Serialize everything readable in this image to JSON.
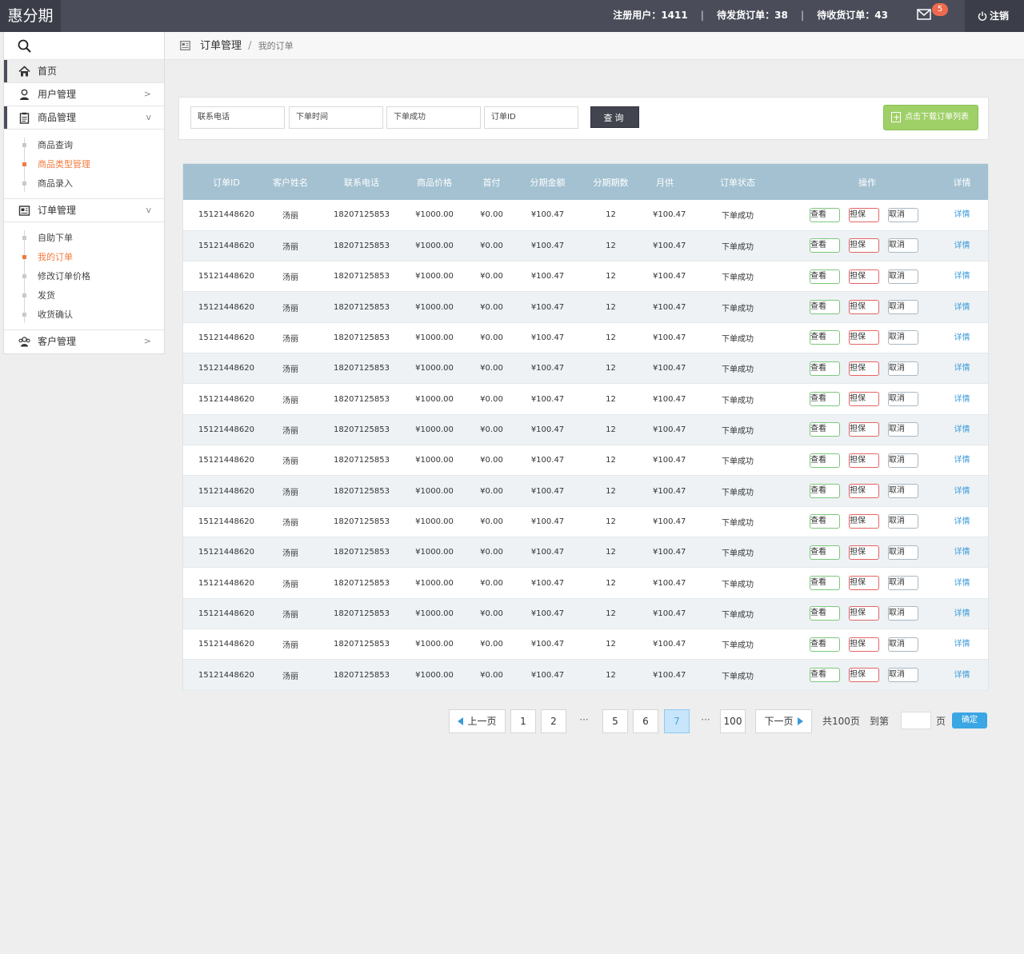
{
  "app": {
    "logo": "惠分期"
  },
  "topbar": {
    "stats": [
      {
        "label": "注册用户：",
        "value": "1411"
      },
      {
        "label": "待发货订单：",
        "value": "38"
      },
      {
        "label": "待收货订单：",
        "value": "43"
      }
    ],
    "separator": "|",
    "mail_badge": "5",
    "logout": "注销"
  },
  "sidebar": {
    "home": "首页",
    "user_mgmt": "用户管理",
    "product_mgmt": "商品管理",
    "product_sub": [
      "商品查询",
      "商品类型管理",
      "商品录入"
    ],
    "order_mgmt": "订单管理",
    "order_sub": [
      "自助下单",
      "我的订单",
      "修改订单价格",
      "发货",
      "收货确认"
    ],
    "customer_mgmt": "客户管理",
    "arrow_right": ">",
    "arrow_down": "v"
  },
  "breadcrumb": {
    "section": "订单管理",
    "sep": "/",
    "current": "我的订单"
  },
  "filter": {
    "phone": "联系电话",
    "time": "下单时间",
    "status": "下单成功",
    "order_id": "订单ID",
    "query": "查询",
    "download": "点击下载订单列表"
  },
  "table": {
    "headers": [
      "订单ID",
      "客户姓名",
      "联系电话",
      "商品价格",
      "首付",
      "分期金额",
      "分期期数",
      "月供",
      "订单状态",
      "操作",
      "详情"
    ],
    "row": {
      "id": "15121448620",
      "name": "汤丽",
      "phone": "18207125853",
      "price": "¥1000.00",
      "down": "¥0.00",
      "amount": "¥100.47",
      "periods": "12",
      "monthly": "¥100.47",
      "status": "下单成功",
      "view": "查看",
      "guarantee": "担保",
      "cancel": "取消",
      "detail": "详情"
    },
    "row_count": 16
  },
  "pagination": {
    "prev": "上一页",
    "pages": [
      "1",
      "2",
      "5",
      "6",
      "7",
      "100"
    ],
    "current": "7",
    "ellipsis": "···",
    "next": "下一页",
    "total": "共100页",
    "goto": "到第",
    "page_unit": "页",
    "confirm": "确定"
  }
}
